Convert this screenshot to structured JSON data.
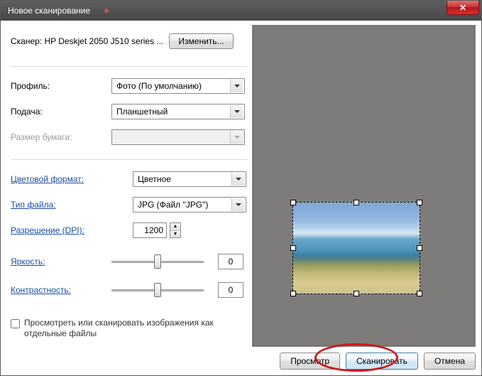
{
  "window": {
    "title": "Новое сканирование"
  },
  "scanner": {
    "label_prefix": "Сканер:",
    "name": "HP Deskjet 2050 J510 series ...",
    "change_btn": "Изменить..."
  },
  "profile": {
    "label": "Профиль:",
    "value": "Фото (По умолчанию)"
  },
  "source": {
    "label": "Подача:",
    "value": "Планшетный"
  },
  "paper": {
    "label": "Размер бумаги:",
    "value": ""
  },
  "color": {
    "label": "Цветовой формат:",
    "value": "Цветное"
  },
  "filetype": {
    "label": "Тип файла:",
    "value": "JPG (Файл \"JPG\")"
  },
  "dpi": {
    "label": "Разрешение (DPI):",
    "value": "1200"
  },
  "brightness": {
    "label": "Яркость:",
    "value": "0"
  },
  "contrast": {
    "label": "Контрастность:",
    "value": "0"
  },
  "separate_files": {
    "label": "Просмотреть или сканировать изображения как отдельные файлы"
  },
  "buttons": {
    "preview": "Просмотр",
    "scan": "Сканировать",
    "cancel": "Отмена"
  }
}
